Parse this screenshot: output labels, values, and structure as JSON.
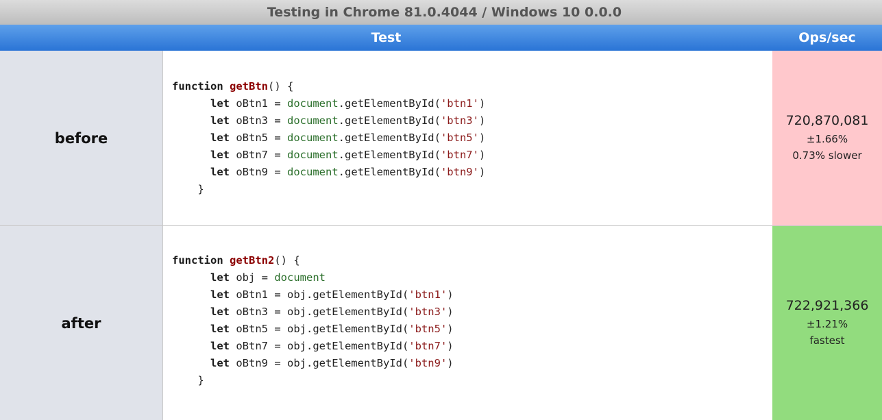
{
  "title": "Testing in Chrome 81.0.4044 / Windows 10 0.0.0",
  "headers": {
    "test": "Test",
    "ops": "Ops/sec"
  },
  "colors": {
    "header_blue": "#2a74d6",
    "slower_bg": "#ffc8cc",
    "fastest_bg": "#92dc7e",
    "name_cell_bg": "#e0e3ea"
  },
  "rows": [
    {
      "name": "before",
      "code_lines": [
        "function getBtn() {",
        "      let oBtn1 = document.getElementById('btn1')",
        "      let oBtn3 = document.getElementById('btn3')",
        "      let oBtn5 = document.getElementById('btn5')",
        "      let oBtn7 = document.getElementById('btn7')",
        "      let oBtn9 = document.getElementById('btn9')",
        "    }"
      ],
      "ops": "720,870,081",
      "error": "±1.66%",
      "status": "0.73% slower"
    },
    {
      "name": "after",
      "code_lines": [
        "function getBtn2() {",
        "      let obj = document",
        "      let oBtn1 = obj.getElementById('btn1')",
        "      let oBtn3 = obj.getElementById('btn3')",
        "      let oBtn5 = obj.getElementById('btn5')",
        "      let oBtn7 = obj.getElementById('btn7')",
        "      let oBtn9 = obj.getElementById('btn9')",
        "    }"
      ],
      "ops": "722,921,366",
      "error": "±1.21%",
      "status": "fastest"
    }
  ]
}
